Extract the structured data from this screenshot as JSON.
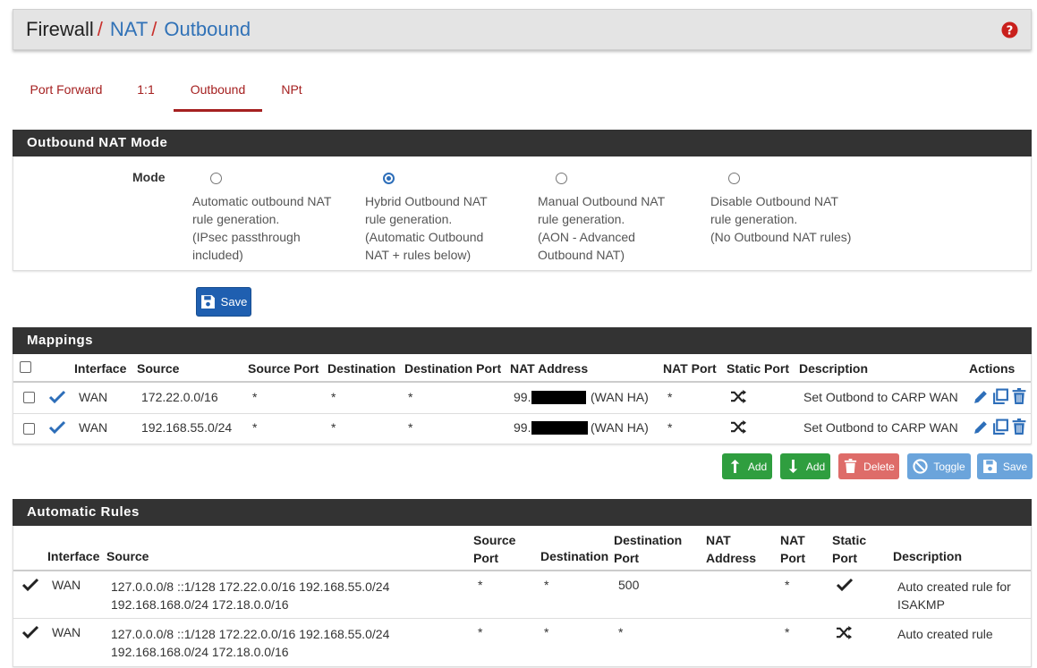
{
  "breadcrumb": {
    "items": [
      "Firewall",
      "NAT",
      "Outbound"
    ],
    "separator": "/"
  },
  "tabs": [
    {
      "label": "Port Forward",
      "active": false
    },
    {
      "label": "1:1",
      "active": false
    },
    {
      "label": "Outbound",
      "active": true
    },
    {
      "label": "NPt",
      "active": false
    }
  ],
  "outbound_mode": {
    "title": "Outbound NAT Mode",
    "label": "Mode",
    "options": [
      {
        "lines": [
          "Automatic outbound NAT",
          "rule generation.",
          "(IPsec passthrough",
          "included)"
        ],
        "selected": false
      },
      {
        "lines": [
          "Hybrid Outbound NAT",
          "rule generation.",
          "(Automatic Outbound",
          "NAT + rules below)"
        ],
        "selected": true
      },
      {
        "lines": [
          "Manual Outbound NAT",
          "rule generation.",
          "(AON - Advanced",
          "Outbound NAT)"
        ],
        "selected": false
      },
      {
        "lines": [
          "Disable Outbound NAT",
          "rule generation.",
          "(No Outbound NAT rules)"
        ],
        "selected": false
      }
    ],
    "save_label": "Save"
  },
  "mappings": {
    "title": "Mappings",
    "columns": [
      "Interface",
      "Source",
      "Source Port",
      "Destination",
      "Destination Port",
      "NAT Address",
      "NAT Port",
      "Static Port",
      "Description",
      "Actions"
    ],
    "rows": [
      {
        "interface": "WAN",
        "source": "172.22.0.0/16",
        "source_port": "*",
        "destination": "*",
        "destination_port": "*",
        "nat_prefix": "99.",
        "nat_suffix": "(WAN HA)",
        "nat_port": "*",
        "static_port": "shuffle",
        "description": "Set Outbond to CARP WAN"
      },
      {
        "interface": "WAN",
        "source": "192.168.55.0/24",
        "source_port": "*",
        "destination": "*",
        "destination_port": "*",
        "nat_prefix": "99.",
        "nat_suffix": "(WAN HA)",
        "nat_port": "*",
        "static_port": "shuffle",
        "description": "Set Outbond to CARP WAN"
      }
    ],
    "buttons": {
      "add_top": "Add",
      "add_bottom": "Add",
      "delete": "Delete",
      "toggle": "Toggle",
      "save": "Save"
    }
  },
  "automatic_rules": {
    "title": "Automatic Rules",
    "columns": {
      "interface": "Interface",
      "source": "Source",
      "source_port": [
        "Source",
        "Port"
      ],
      "destination": "Destination",
      "destination_port": [
        "Destination",
        "Port"
      ],
      "nat_address": [
        "NAT",
        "Address"
      ],
      "nat_port": [
        "NAT",
        "Port"
      ],
      "static_port": [
        "Static",
        "Port"
      ],
      "description": "Description"
    },
    "rows": [
      {
        "interface": "WAN",
        "source_lines": [
          "127.0.0.0/8 ::1/128 172.22.0.0/16 192.168.55.0/24",
          "192.168.168.0/24 172.18.0.0/16"
        ],
        "source_port": "*",
        "destination": "*",
        "destination_port": "500",
        "nat_address": "",
        "nat_port": "*",
        "static_port": "check",
        "description_lines": [
          "Auto created rule for",
          "ISAKMP"
        ]
      },
      {
        "interface": "WAN",
        "source_lines": [
          "127.0.0.0/8 ::1/128 172.22.0.0/16 192.168.55.0/24",
          "192.168.168.0/24 172.18.0.0/16"
        ],
        "source_port": "*",
        "destination": "*",
        "destination_port": "*",
        "nat_address": "",
        "nat_port": "*",
        "static_port": "shuffle",
        "description_lines": [
          "Auto created rule"
        ]
      }
    ]
  },
  "colors": {
    "accent_red": "#a52020",
    "link_blue": "#3172b7",
    "panel_dark": "#333333",
    "primary_blue": "#1f5fb0",
    "success_green": "#2f9e3f",
    "danger_red": "#d9534f"
  }
}
